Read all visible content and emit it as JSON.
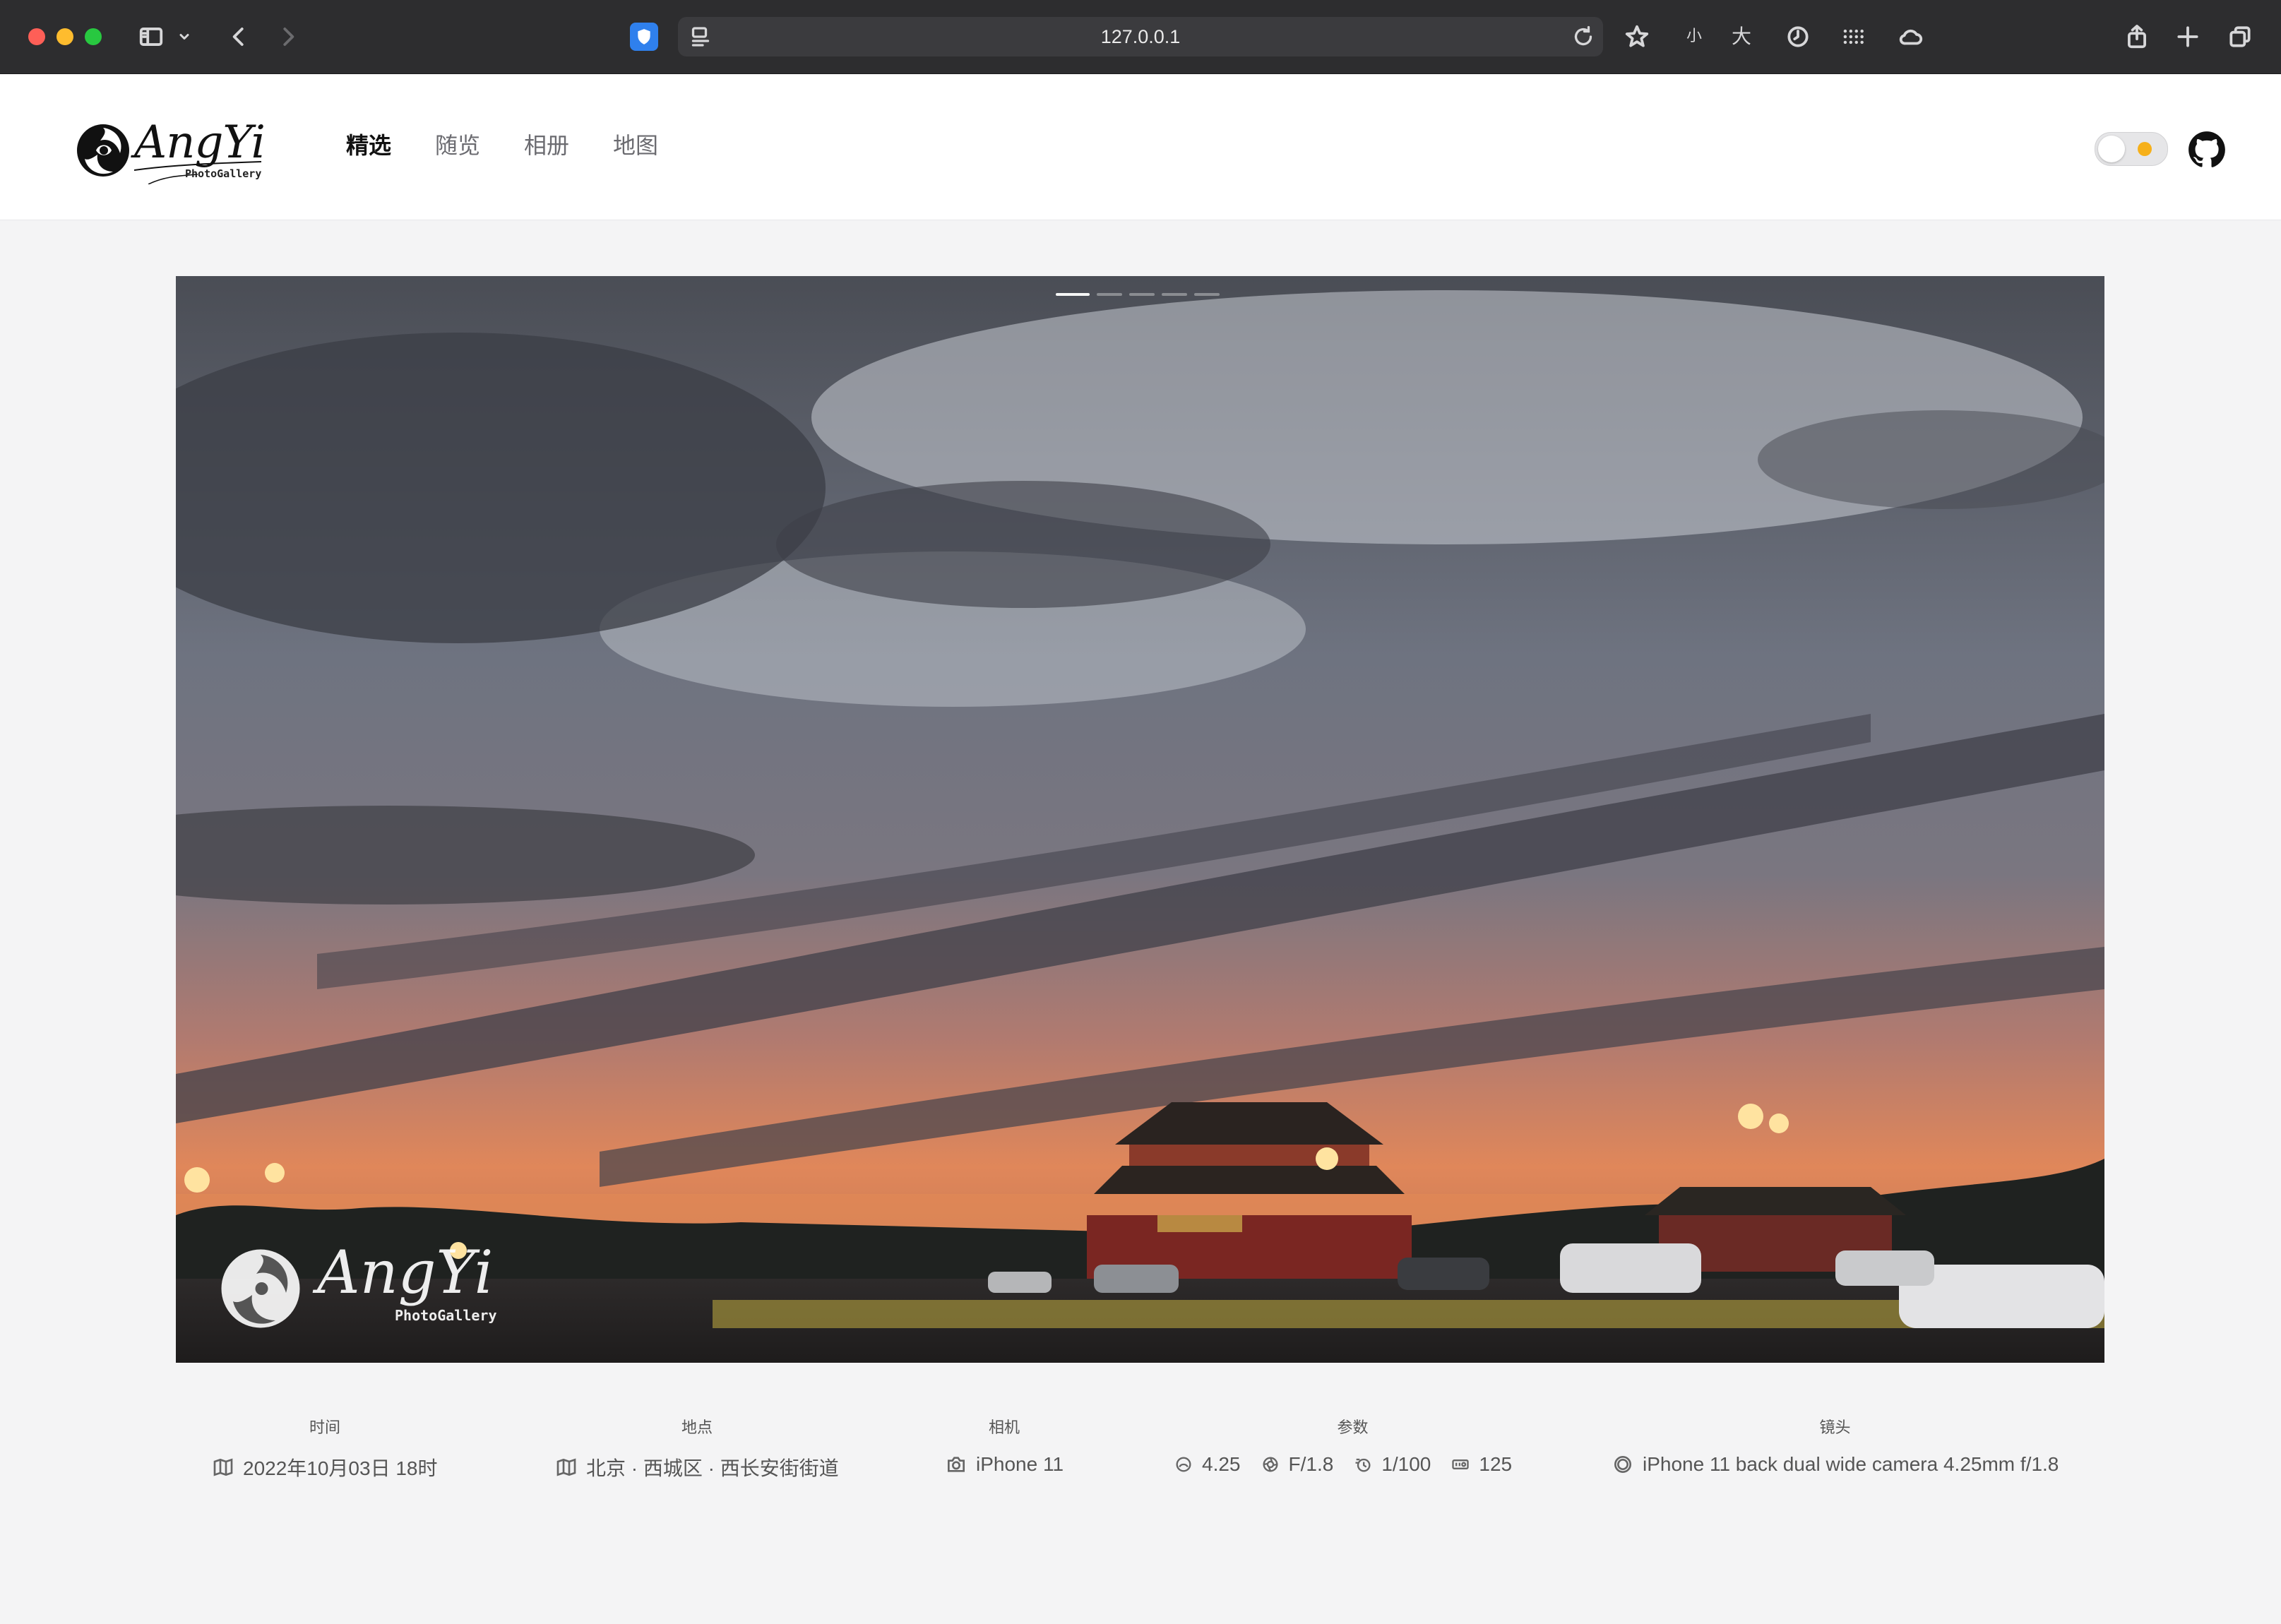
{
  "browser": {
    "url": "127.0.0.1",
    "font_small_label": "小",
    "font_large_label": "大"
  },
  "site": {
    "logo_text": "AngYi",
    "logo_sub": "PhotoGallery",
    "nav": [
      {
        "label": "精选",
        "active": true
      },
      {
        "label": "随览",
        "active": false
      },
      {
        "label": "相册",
        "active": false
      },
      {
        "label": "地图",
        "active": false
      }
    ],
    "theme_toggle": "light"
  },
  "carousel": {
    "slide_count": 5,
    "active_slide": 1,
    "watermark_text": "AngYi",
    "watermark_sub": "PhotoGallery"
  },
  "meta": {
    "time_label": "时间",
    "time_value": "2022年10月03日 18时",
    "location_label": "地点",
    "location_value": "北京 · 西城区 · 西长安街街道",
    "camera_label": "相机",
    "camera_value": "iPhone 11",
    "params_label": "参数",
    "focal_length": "4.25",
    "aperture": "F/1.8",
    "shutter": "1/100",
    "iso": "125",
    "lens_label": "镜头",
    "lens_value": "iPhone 11 back dual wide camera 4.25mm f/1.8"
  },
  "colors": {
    "accent_toggle_sun": "#f6b01a",
    "chrome_bg": "#2d2d2f",
    "page_bg": "#f4f4f5"
  }
}
